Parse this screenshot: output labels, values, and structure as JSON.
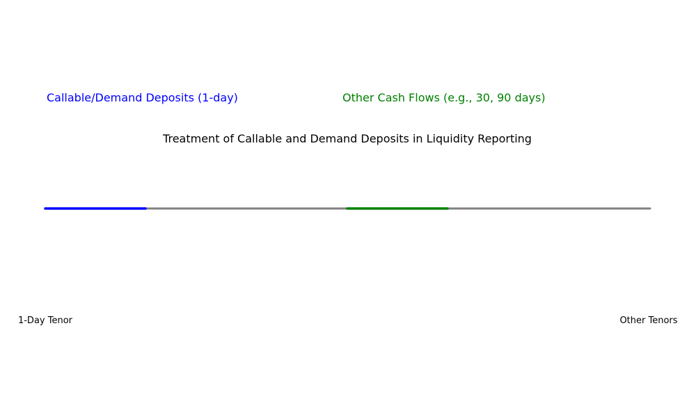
{
  "title": "Treatment of Callable and Demand Deposits in Liquidity Reporting",
  "segments": {
    "callable": {
      "label": "Callable/Demand Deposits (1-day)",
      "color": "#0000ff"
    },
    "other": {
      "label": "Other Cash Flows (e.g., 30, 90 days)",
      "color": "#008000"
    }
  },
  "axis": {
    "color": "#808080",
    "left_label": "1-Day Tenor",
    "right_label": "Other Tenors"
  }
}
